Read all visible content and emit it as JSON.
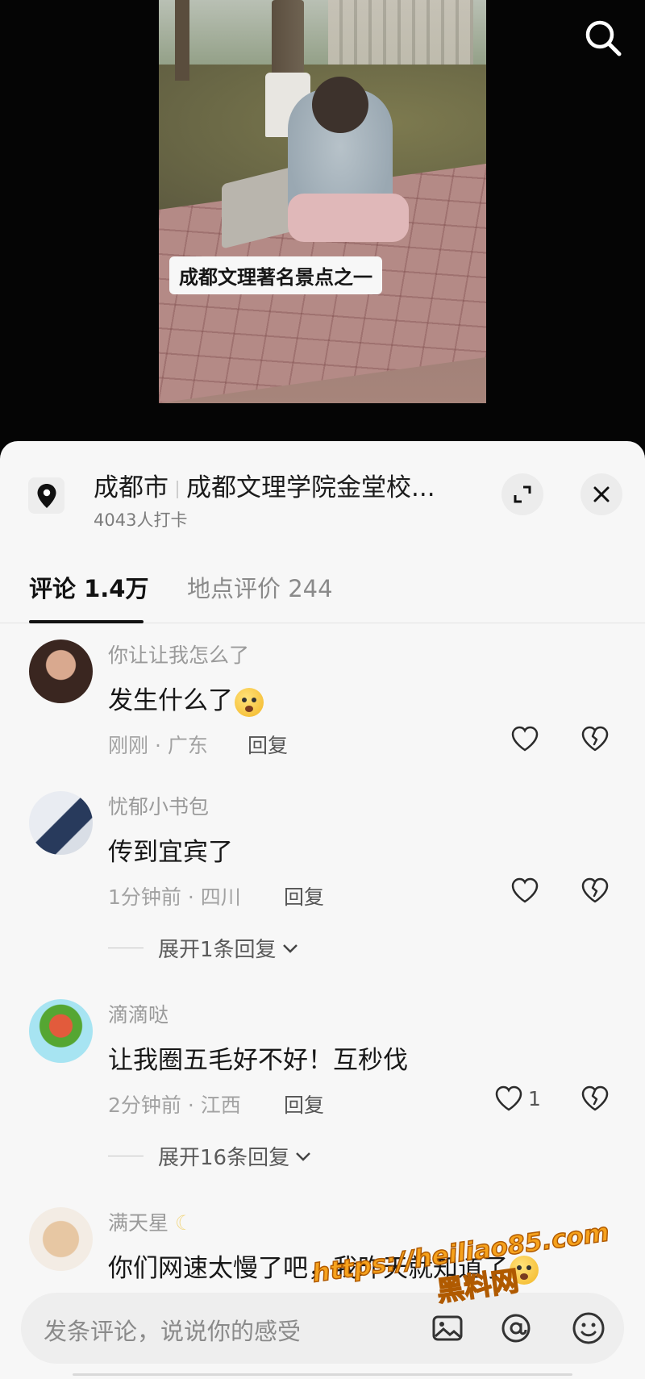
{
  "video": {
    "caption": "成都文理著名景点之一",
    "search_icon": "search-icon"
  },
  "location": {
    "city": "成都市",
    "place": "成都文理学院金堂校...",
    "checkins": "4043人打卡",
    "pin_icon": "map-pin-icon",
    "expand_icon": "expand-icon",
    "close_icon": "close-icon"
  },
  "tabs": [
    {
      "label": "评论 1.4万",
      "active": true
    },
    {
      "label": "地点评价 244",
      "active": false
    }
  ],
  "comments": [
    {
      "user": "你让让我怎么了",
      "text": "发生什么了",
      "time": "刚刚 · 广东",
      "reply": "回复",
      "likes": "",
      "emoji": "surprised-face"
    },
    {
      "user": "忧郁小书包",
      "text": "传到宜宾了",
      "time": "1分钟前 · 四川",
      "reply": "回复",
      "likes": "",
      "expand": "展开1条回复"
    },
    {
      "user": "滴滴哒",
      "text": "让我圈五毛好不好！互秒伐",
      "time": "2分钟前 · 江西",
      "reply": "回复",
      "likes": "1",
      "expand": "展开16条回复"
    },
    {
      "user": "满天星",
      "text": "你们网速太慢了吧，我昨天就知道了",
      "emoji": "surprised-face"
    }
  ],
  "input": {
    "placeholder": "发条评论，说说你的感受",
    "icons": [
      "image-icon",
      "at-icon",
      "emoji-icon"
    ]
  },
  "watermark": {
    "url": "https://heiliao85.com",
    "name": "黑料网"
  },
  "colors": {
    "sheet_bg": "#f7f7f7",
    "watermark": "#f6a21c",
    "text_primary": "#171717",
    "text_secondary": "#9a9a9a"
  }
}
